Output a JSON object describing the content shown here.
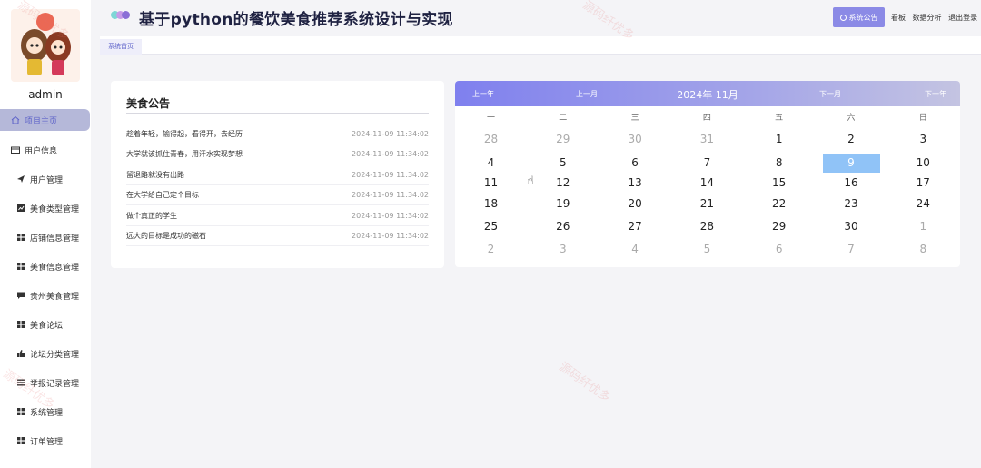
{
  "app": {
    "title": "基于python的餐饮美食推荐系统设计与实现",
    "logo_colors": [
      "#7ed6d6",
      "#c79be8",
      "#8b6fd6"
    ]
  },
  "header": {
    "notice_button": "系统公告",
    "links": [
      "看板",
      "数据分析",
      "退出登录"
    ]
  },
  "user": {
    "name": "admin"
  },
  "sidebar": {
    "items": [
      {
        "label": "项目主页",
        "icon": "home-icon",
        "active": true,
        "level": "top"
      },
      {
        "label": "用户信息",
        "icon": "card-icon",
        "active": false,
        "level": "top"
      },
      {
        "label": "用户管理",
        "icon": "send-icon",
        "active": false,
        "level": "sub"
      },
      {
        "label": "美食类型管理",
        "icon": "chart-icon",
        "active": false,
        "level": "sub"
      },
      {
        "label": "店铺信息管理",
        "icon": "grid-icon",
        "active": false,
        "level": "sub"
      },
      {
        "label": "美食信息管理",
        "icon": "grid-icon",
        "active": false,
        "level": "sub"
      },
      {
        "label": "贵州美食管理",
        "icon": "message-icon",
        "active": false,
        "level": "sub"
      },
      {
        "label": "美食论坛",
        "icon": "grid-icon",
        "active": false,
        "level": "sub"
      },
      {
        "label": "论坛分类管理",
        "icon": "thumb-icon",
        "active": false,
        "level": "sub"
      },
      {
        "label": "举报记录管理",
        "icon": "list-icon",
        "active": false,
        "level": "sub"
      },
      {
        "label": "系统管理",
        "icon": "grid-icon",
        "active": false,
        "level": "sub"
      },
      {
        "label": "订单管理",
        "icon": "grid-icon",
        "active": false,
        "level": "sub"
      }
    ]
  },
  "breadcrumb": {
    "tab": "系统首页"
  },
  "announcements": {
    "title": "美食公告",
    "items": [
      {
        "text": "趁着年轻，输得起，看得开，去经历",
        "date": "2024-11-09 11:34:02"
      },
      {
        "text": "大学就该抓住青春，用汗水实现梦想",
        "date": "2024-11-09 11:34:02"
      },
      {
        "text": "留退路就没有出路",
        "date": "2024-11-09 11:34:02"
      },
      {
        "text": "在大学给自己定个目标",
        "date": "2024-11-09 11:34:02"
      },
      {
        "text": "做个真正的学生",
        "date": "2024-11-09 11:34:02"
      },
      {
        "text": "远大的目标是成功的磁石",
        "date": "2024-11-09 11:34:02"
      }
    ]
  },
  "calendar": {
    "prev_year": "上一年",
    "prev_month": "上一月",
    "month_label": "2024年 11月",
    "next_month": "下一月",
    "next_year": "下一年",
    "weekdays": [
      "一",
      "二",
      "三",
      "四",
      "五",
      "六",
      "日"
    ],
    "weeks": [
      [
        {
          "d": "28",
          "o": true
        },
        {
          "d": "29",
          "o": true
        },
        {
          "d": "30",
          "o": true
        },
        {
          "d": "31",
          "o": true
        },
        {
          "d": "1"
        },
        {
          "d": "2"
        },
        {
          "d": "3"
        }
      ],
      [
        {
          "d": "4"
        },
        {
          "d": "5"
        },
        {
          "d": "6"
        },
        {
          "d": "7"
        },
        {
          "d": "8"
        },
        {
          "d": "9",
          "today": true
        },
        {
          "d": "10"
        }
      ],
      [
        {
          "d": "11"
        },
        {
          "d": "12"
        },
        {
          "d": "13"
        },
        {
          "d": "14"
        },
        {
          "d": "15"
        },
        {
          "d": "16"
        },
        {
          "d": "17"
        }
      ],
      [
        {
          "d": "18"
        },
        {
          "d": "19"
        },
        {
          "d": "20"
        },
        {
          "d": "21"
        },
        {
          "d": "22"
        },
        {
          "d": "23"
        },
        {
          "d": "24"
        }
      ],
      [
        {
          "d": "25"
        },
        {
          "d": "26"
        },
        {
          "d": "27"
        },
        {
          "d": "28"
        },
        {
          "d": "29"
        },
        {
          "d": "30"
        },
        {
          "d": "1",
          "o": true
        }
      ],
      [
        {
          "d": "2",
          "o": true
        },
        {
          "d": "3",
          "o": true
        },
        {
          "d": "4",
          "o": true
        },
        {
          "d": "5",
          "o": true
        },
        {
          "d": "6",
          "o": true
        },
        {
          "d": "7",
          "o": true
        },
        {
          "d": "8",
          "o": true
        }
      ]
    ],
    "today_color": "#90c3f7"
  },
  "watermark": "源码纤优多",
  "colors": {
    "accent": "#8b8ae6",
    "active_nav_bg": "#b5b8d9"
  }
}
